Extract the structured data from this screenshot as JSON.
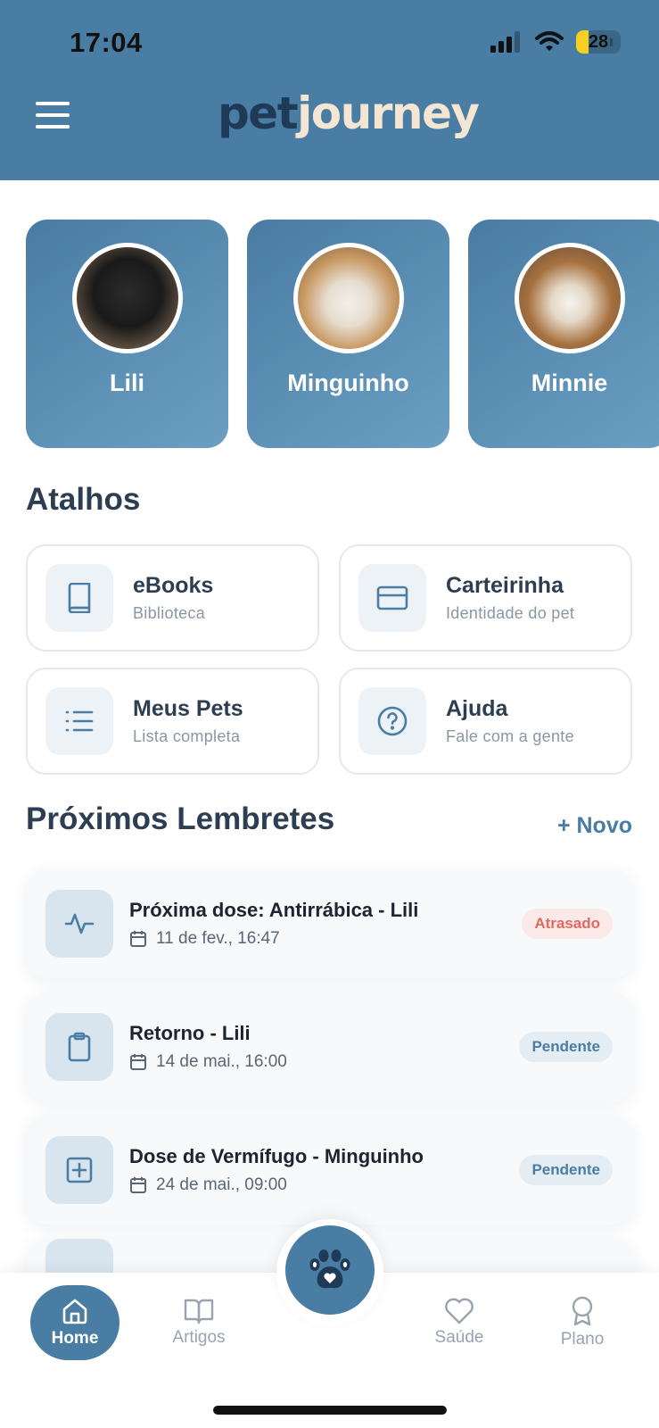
{
  "status_bar": {
    "time": "17:04",
    "battery": "28"
  },
  "header": {
    "logo_part1": "pet",
    "logo_part2": "journey"
  },
  "pets": [
    {
      "name": "Lili"
    },
    {
      "name": "Minguinho"
    },
    {
      "name": "Minnie"
    }
  ],
  "shortcuts": {
    "title": "Atalhos",
    "items": [
      {
        "title": "eBooks",
        "subtitle": "Biblioteca",
        "icon": "book-icon"
      },
      {
        "title": "Carteirinha",
        "subtitle": "Identidade do pet",
        "icon": "card-icon"
      },
      {
        "title": "Meus Pets",
        "subtitle": "Lista completa",
        "icon": "list-icon"
      },
      {
        "title": "Ajuda",
        "subtitle": "Fale com a gente",
        "icon": "help-icon"
      }
    ]
  },
  "reminders": {
    "title": "Próximos Lembretes",
    "new_label": "+ Novo",
    "items": [
      {
        "title": "Próxima dose: Antirrábica - Lili",
        "date": "11 de fev., 16:47",
        "status": "Atrasado",
        "icon": "pulse-icon"
      },
      {
        "title": "Retorno - Lili",
        "date": "14 de mai., 16:00",
        "status": "Pendente",
        "icon": "clipboard-icon"
      },
      {
        "title": "Dose de Vermífugo - Minguinho",
        "date": "24 de mai., 09:00",
        "status": "Pendente",
        "icon": "plus-square-icon"
      }
    ]
  },
  "nav": {
    "home": "Home",
    "articles": "Artigos",
    "health": "Saúde",
    "plan": "Plano"
  },
  "colors": {
    "primary": "#4a7da3",
    "late": "#e06a62"
  }
}
